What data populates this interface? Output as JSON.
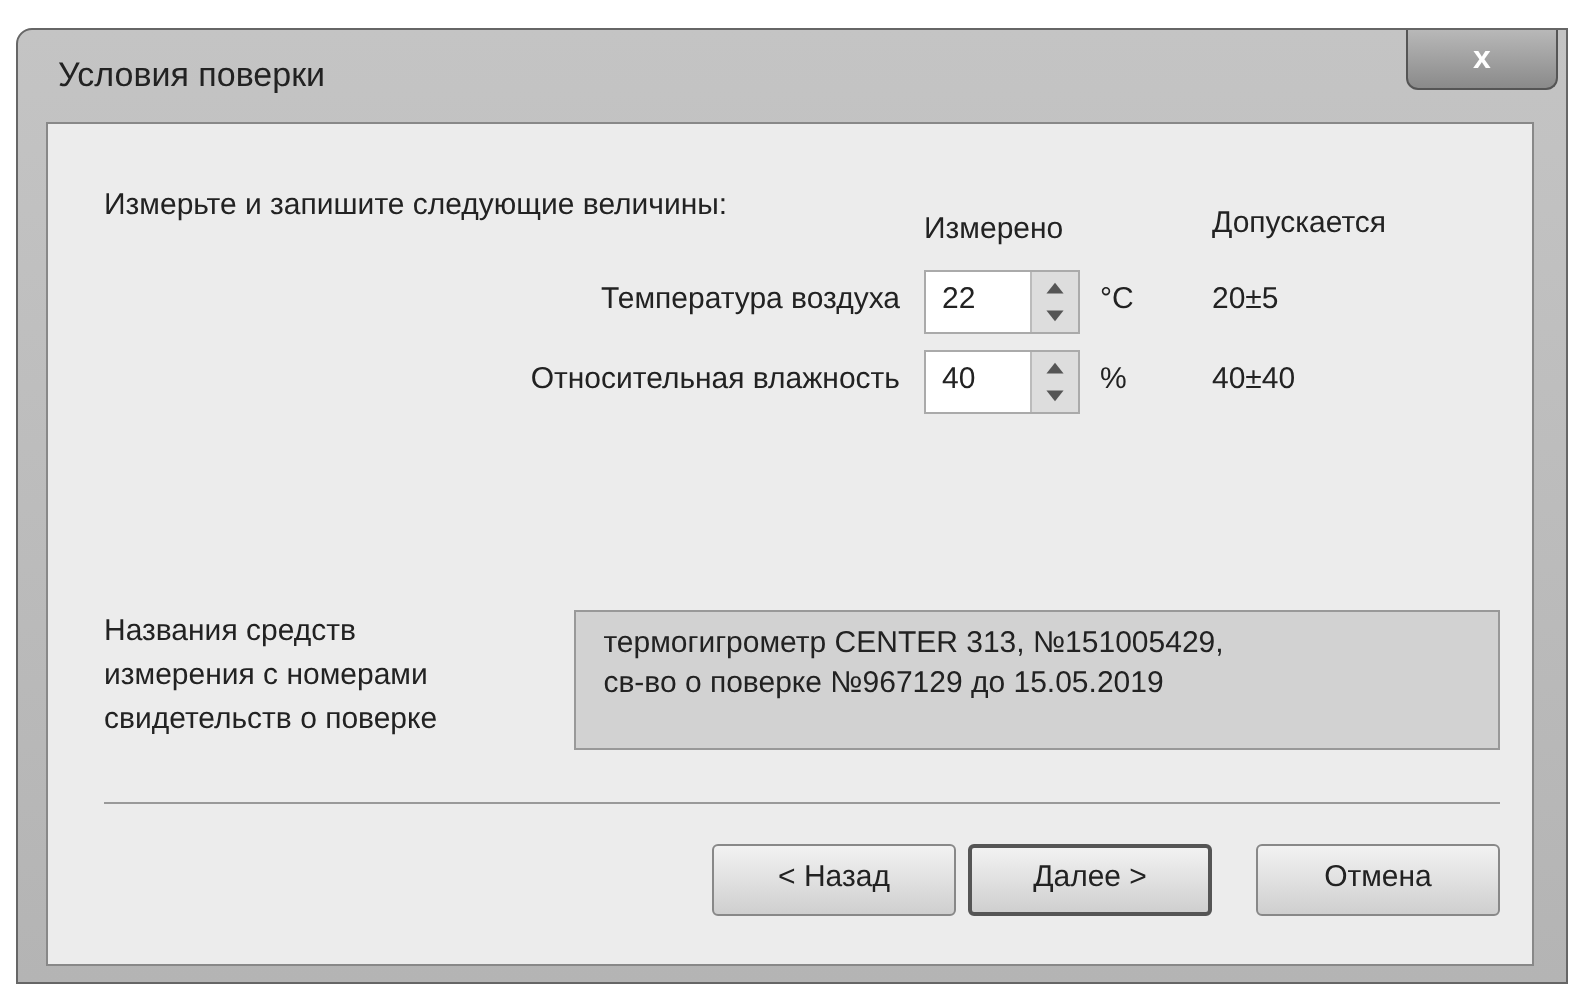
{
  "window": {
    "title": "Условия поверки",
    "close": "x"
  },
  "instruction": "Измерьте и запишите следующие величины:",
  "columns": [
    "Измерено",
    "Допускается"
  ],
  "rows": [
    {
      "label": "Температура воздуха",
      "value": "22",
      "unit": "°C",
      "tolerance": "20±5"
    },
    {
      "label": "Относительная влажность",
      "value": "40",
      "unit": "%",
      "tolerance": "40±40"
    }
  ],
  "instruments": {
    "label": [
      "Названия средств",
      "измерения с номерами",
      "свидетельств о поверке"
    ],
    "lines": [
      "термогигрометр CENTER 313, №151005429,",
      "св-во о поверке №967129 до 15.05.2019"
    ]
  },
  "buttons": [
    {
      "label": "< Назад",
      "default": false
    },
    {
      "label": "Далее >",
      "default": true
    },
    {
      "label": "Отмена",
      "default": false
    }
  ]
}
